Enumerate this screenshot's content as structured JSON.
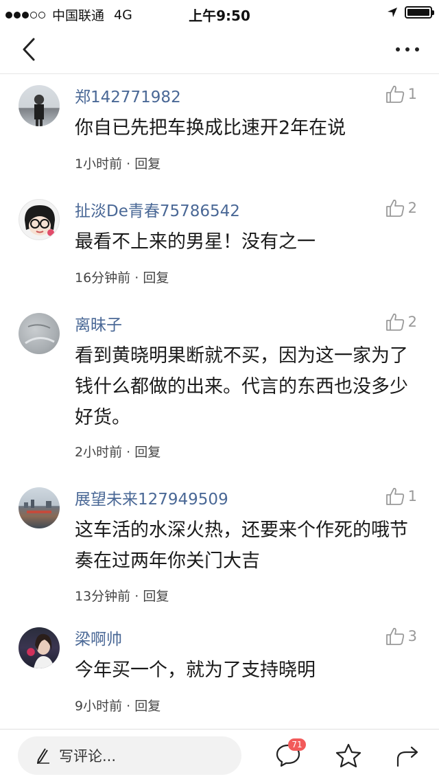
{
  "status_bar": {
    "carrier": "中国联通",
    "network": "4G",
    "time": "上午9:50"
  },
  "nav": {
    "back_icon": "chevron-left-icon",
    "more_icon": "more-horizontal-icon"
  },
  "comments": [
    {
      "username": "郑142771982",
      "text": "你自已先把车换成比速开2年在说",
      "time": "1小时前",
      "reply_label": "回复",
      "likes": "1"
    },
    {
      "username": "扯淡De青春75786542",
      "text": "最看不上来的男星！没有之一",
      "time": "16分钟前",
      "reply_label": "回复",
      "likes": "2"
    },
    {
      "username": "离昧子",
      "text": "看到黄晓明果断就不买，因为这一家为了钱什么都做的出来。代言的东西也没多少好货。",
      "time": "2小时前",
      "reply_label": "回复",
      "likes": "2"
    },
    {
      "username": "展望未来127949509",
      "text": "这车活的水深火热，还要来个作死的哦节奏在过两年你关门大吉",
      "time": "13分钟前",
      "reply_label": "回复",
      "likes": "1"
    },
    {
      "username": "梁啊帅",
      "text": "今年买一个，就为了支持晓明",
      "time": "9小时前",
      "reply_label": "回复",
      "likes": "3"
    }
  ],
  "bottom_bar": {
    "placeholder": "写评论...",
    "comment_count": "71",
    "icons": [
      "pencil-icon",
      "comment-bubble-icon",
      "star-icon",
      "share-icon"
    ]
  },
  "colors": {
    "username": "#4a6896",
    "badge": "#f25a5a"
  }
}
